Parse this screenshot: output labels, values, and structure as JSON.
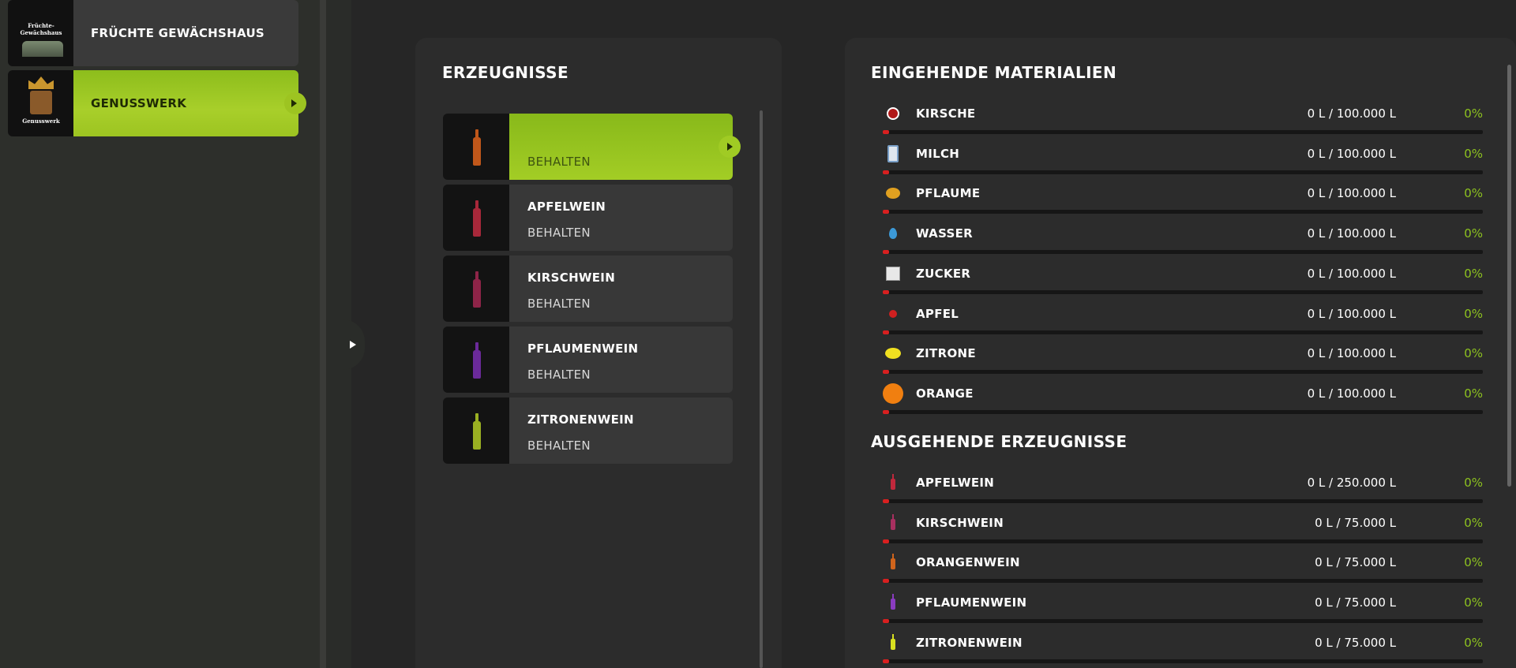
{
  "productions": [
    {
      "label": "FRÜCHTE GEWÄCHSHAUS",
      "thumb_line1": "Früchte-",
      "thumb_line2": "Gewächshaus",
      "active": false
    },
    {
      "label": "GENUSSWERK",
      "thumb_line1": "Genusswerk",
      "active": true
    }
  ],
  "products_panel": {
    "title": "ERZEUGNISSE",
    "items": [
      {
        "name": "",
        "status": "BEHALTEN",
        "bottle_color": "#c0571a",
        "active": true
      },
      {
        "name": "APFELWEIN",
        "status": "BEHALTEN",
        "bottle_color": "#a8283a",
        "active": false
      },
      {
        "name": "KIRSCHWEIN",
        "status": "BEHALTEN",
        "bottle_color": "#8e2448",
        "active": false
      },
      {
        "name": "PFLAUMENWEIN",
        "status": "BEHALTEN",
        "bottle_color": "#6b2a9a",
        "active": false
      },
      {
        "name": "ZITRONENWEIN",
        "status": "BEHALTEN",
        "bottle_color": "#9ab022",
        "active": false
      }
    ]
  },
  "incoming": {
    "title": "EINGEHENDE MATERIALIEN",
    "rows": [
      {
        "icon": "cherry-icon",
        "label": "KIRSCHE",
        "amount": "0 L / 100.000 L",
        "percent": "0%",
        "fill_fraction": 0
      },
      {
        "icon": "milk-icon",
        "label": "MILCH",
        "amount": "0 L / 100.000 L",
        "percent": "0%",
        "fill_fraction": 0
      },
      {
        "icon": "plum-icon",
        "label": "PFLAUME",
        "amount": "0 L / 100.000 L",
        "percent": "0%",
        "fill_fraction": 0
      },
      {
        "icon": "water-icon",
        "label": "WASSER",
        "amount": "0 L / 100.000 L",
        "percent": "0%",
        "fill_fraction": 0
      },
      {
        "icon": "sugar-icon",
        "label": "ZUCKER",
        "amount": "0 L / 100.000 L",
        "percent": "0%",
        "fill_fraction": 0
      },
      {
        "icon": "apple-icon",
        "label": "APFEL",
        "amount": "0 L / 100.000 L",
        "percent": "0%",
        "fill_fraction": 0
      },
      {
        "icon": "lemon-icon",
        "label": "ZITRONE",
        "amount": "0 L / 100.000 L",
        "percent": "0%",
        "fill_fraction": 0
      },
      {
        "icon": "orange-icon",
        "label": "ORANGE",
        "amount": "0 L / 100.000 L",
        "percent": "0%",
        "fill_fraction": 0
      }
    ]
  },
  "outgoing": {
    "title": "AUSGEHENDE ERZEUGNISSE",
    "rows": [
      {
        "icon": "apple-wine-bottle-icon",
        "label": "APFELWEIN",
        "amount": "0 L / 250.000 L",
        "percent": "0%",
        "bottle_color": "#c0283c",
        "fill_fraction": 0
      },
      {
        "icon": "cherry-wine-bottle-icon",
        "label": "KIRSCHWEIN",
        "amount": "0 L / 75.000 L",
        "percent": "0%",
        "bottle_color": "#a83060",
        "fill_fraction": 0
      },
      {
        "icon": "orange-wine-bottle-icon",
        "label": "ORANGENWEIN",
        "amount": "0 L / 75.000 L",
        "percent": "0%",
        "bottle_color": "#d0641c",
        "fill_fraction": 0
      },
      {
        "icon": "plum-wine-bottle-icon",
        "label": "PFLAUMENWEIN",
        "amount": "0 L / 75.000 L",
        "percent": "0%",
        "bottle_color": "#8a3cc0",
        "fill_fraction": 0
      },
      {
        "icon": "lemon-wine-bottle-icon",
        "label": "ZITRONENWEIN",
        "amount": "0 L / 75.000 L",
        "percent": "0%",
        "bottle_color": "#d8e020",
        "fill_fraction": 0
      }
    ]
  },
  "colors": {
    "accent_green": "#9dc421",
    "percent_green": "#8dc21f",
    "bar_fill_red": "#d82020"
  }
}
